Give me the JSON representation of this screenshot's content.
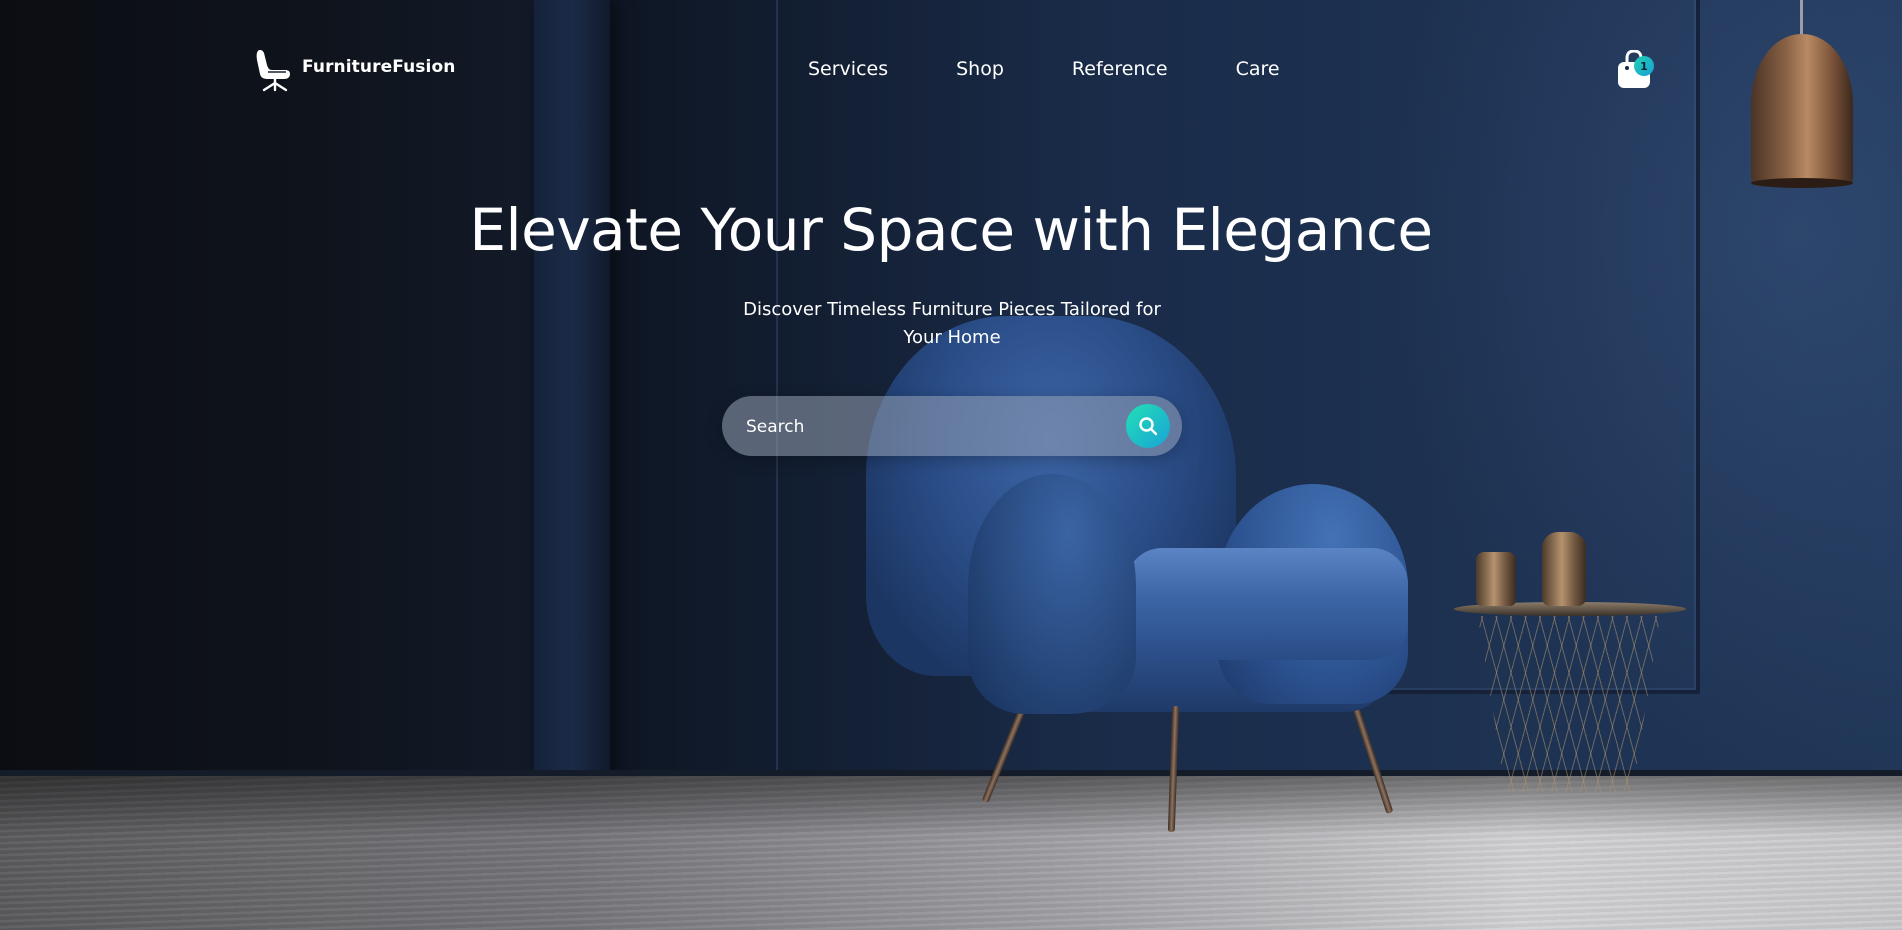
{
  "brand": {
    "name": "FurnitureFusion"
  },
  "nav": {
    "items": [
      {
        "label": "Services"
      },
      {
        "label": "Shop"
      },
      {
        "label": "Reference"
      },
      {
        "label": "Care"
      }
    ]
  },
  "cart": {
    "count": "1",
    "icon": "shopping-bag-icon"
  },
  "hero": {
    "title": "Elevate Your Space with Elegance",
    "subtitle": "Discover Timeless Furniture Pieces Tailored for Your Home"
  },
  "search": {
    "placeholder": "Search",
    "value": "",
    "icon": "search-icon"
  },
  "colors": {
    "accent_gradient_start": "#22e0b5",
    "accent_gradient_end": "#1aa3d6",
    "wall": "#1a2c4a",
    "chair": "#3b65a6",
    "text": "#ffffff"
  }
}
